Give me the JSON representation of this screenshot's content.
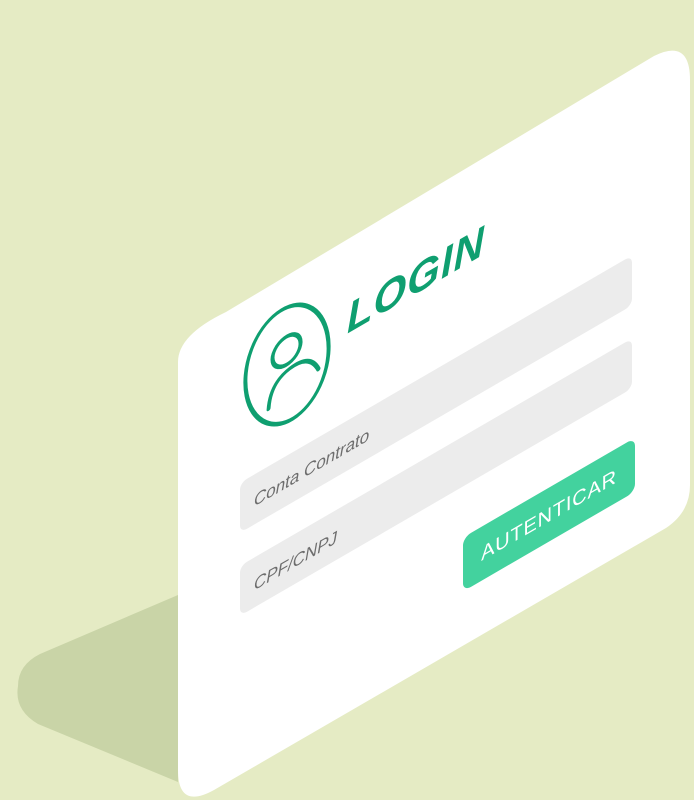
{
  "login": {
    "title": "LOGIN",
    "fields": [
      {
        "placeholder": "Conta Contrato",
        "value": ""
      },
      {
        "placeholder": "CPF/CNPJ",
        "value": ""
      }
    ],
    "submit_label": "AUTENTICAR"
  },
  "colors": {
    "background": "#e5ebc4",
    "shadow": "#c9d4a7",
    "card": "#ffffff",
    "input": "#ececec",
    "accent_text": "#0f9f70",
    "button": "#43d29e",
    "button_text": "#ffffff"
  },
  "icons": {
    "user": "user-icon"
  }
}
